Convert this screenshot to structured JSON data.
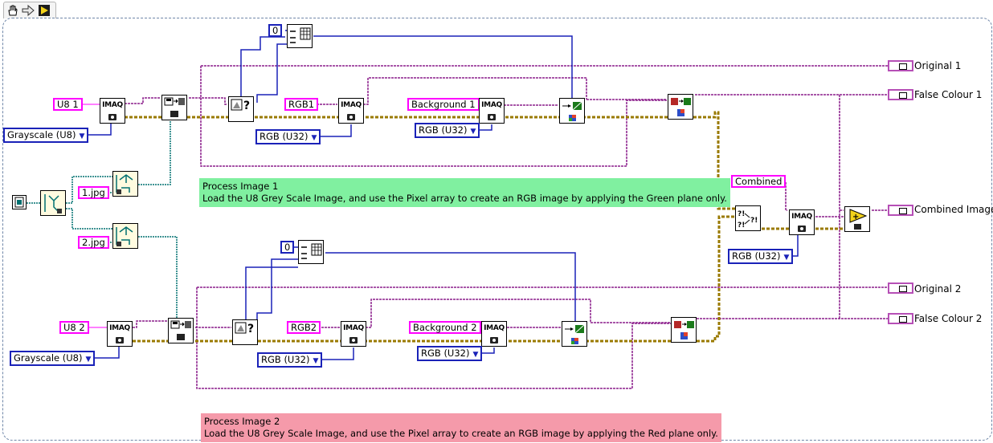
{
  "toolbar": {
    "tools": [
      "hand-icon",
      "arrow-icon",
      "run-arrow-icon"
    ]
  },
  "diagram": {
    "constants": {
      "u8_1": "U8 1",
      "u8_2": "U8 2",
      "rgb1": "RGB1",
      "rgb2": "RGB2",
      "background_1": "Background 1",
      "background_2": "Background 2",
      "jpg_1": "1.jpg",
      "jpg_2": "2.jpg",
      "combined": "Combined",
      "zero_1": "0",
      "zero_2": "0"
    },
    "enums": {
      "grayscale_1": "Grayscale (U8)",
      "grayscale_2": "Grayscale (U8)",
      "rgb_u32_1": "RGB (U32)",
      "rgb_u32_2": "RGB (U32)",
      "rgb_u32_3": "RGB (U32)",
      "rgb_u32_4": "RGB (U32)",
      "rgb_u32_5": "RGB (U32)"
    },
    "vi_labels": {
      "imaq": "IMAQ",
      "question": "?"
    },
    "indicators": [
      {
        "label": "Original 1"
      },
      {
        "label": "False Colour 1"
      },
      {
        "label": "Combined Image"
      },
      {
        "label": "Original 2"
      },
      {
        "label": "False Colour 2"
      }
    ],
    "comments": {
      "process1": {
        "title": "Process Image 1",
        "body": "Load the U8 Grey Scale Image, and use the Pixel array to create an RGB image by applying the Green plane only.",
        "color": "#80f0a0"
      },
      "process2": {
        "title": "Process Image 2",
        "body": "Load the U8 Grey Scale Image, and use the Pixel array to create an RGB image by applying the Red plane only.",
        "color": "#f59aaa"
      }
    },
    "wire_colors": {
      "image": "#8b1f8b",
      "enum": "#1a22b8",
      "path": "#007070",
      "cluster": "#9a7a00"
    }
  }
}
